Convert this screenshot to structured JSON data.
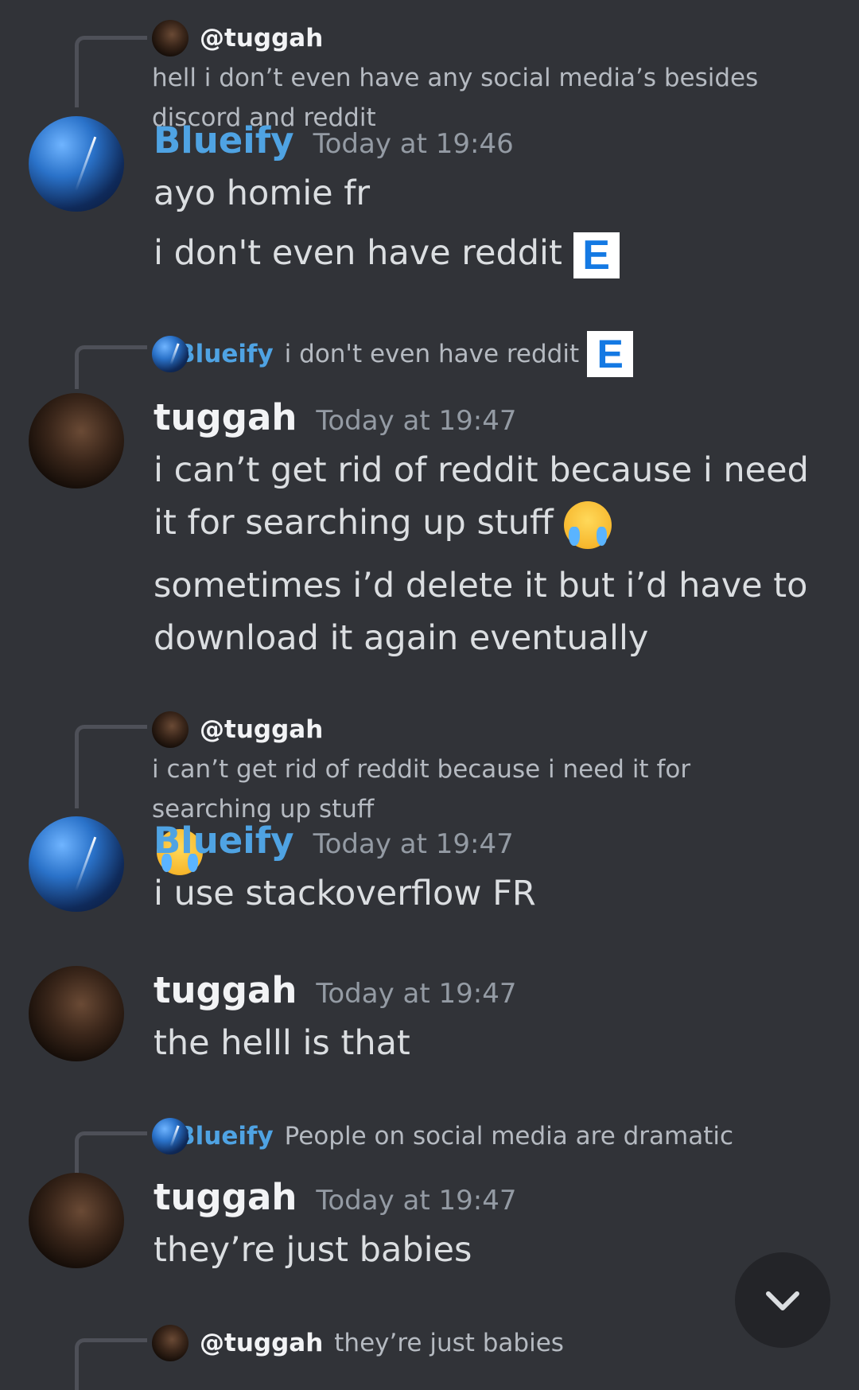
{
  "messages": [
    {
      "reply": {
        "mention": "@tuggah",
        "text": "hell i don’t even have any social media’s besides discord and reddit"
      },
      "author": "Blueify",
      "time": "Today at 19:46",
      "lines": [
        "ayo homie fr",
        "i don't even have reddit"
      ]
    },
    {
      "reply": {
        "mention": "@Blueify",
        "text": "i don't even have reddit"
      },
      "author": "tuggah",
      "time": "Today at 19:47",
      "lines": [
        "i can’t get rid of reddit because i need it for searching up stuff",
        "sometimes i’d delete it but i’d have to download it again eventually"
      ]
    },
    {
      "reply": {
        "mention": "@tuggah",
        "text": "i can’t get rid of reddit because i need it for searching up stuff"
      },
      "author": "Blueify",
      "time": "Today at 19:47",
      "lines": [
        "i use stackoverflow FR"
      ]
    },
    {
      "author": "tuggah",
      "time": "Today at 19:47",
      "lines": [
        "the helll is that"
      ]
    },
    {
      "reply": {
        "mention": "@Blueify",
        "text": "People on social media are dramatic"
      },
      "author": "tuggah",
      "time": "Today at 19:47",
      "lines": [
        "they’re just babies"
      ]
    },
    {
      "reply": {
        "mention": "@tuggah",
        "text": "they’re just babies"
      }
    }
  ],
  "emoji": {
    "e_letter": "E"
  },
  "icons": {
    "avatar_blueify": "night-sky-avatar",
    "avatar_tuggah": "portrait-avatar",
    "scroll_down": "chevron-down-icon"
  },
  "colors": {
    "background": "#313338",
    "blueify_name": "#4fa3e3",
    "tuggah_name": "#f2f3f5",
    "timestamp": "#949ba4"
  }
}
